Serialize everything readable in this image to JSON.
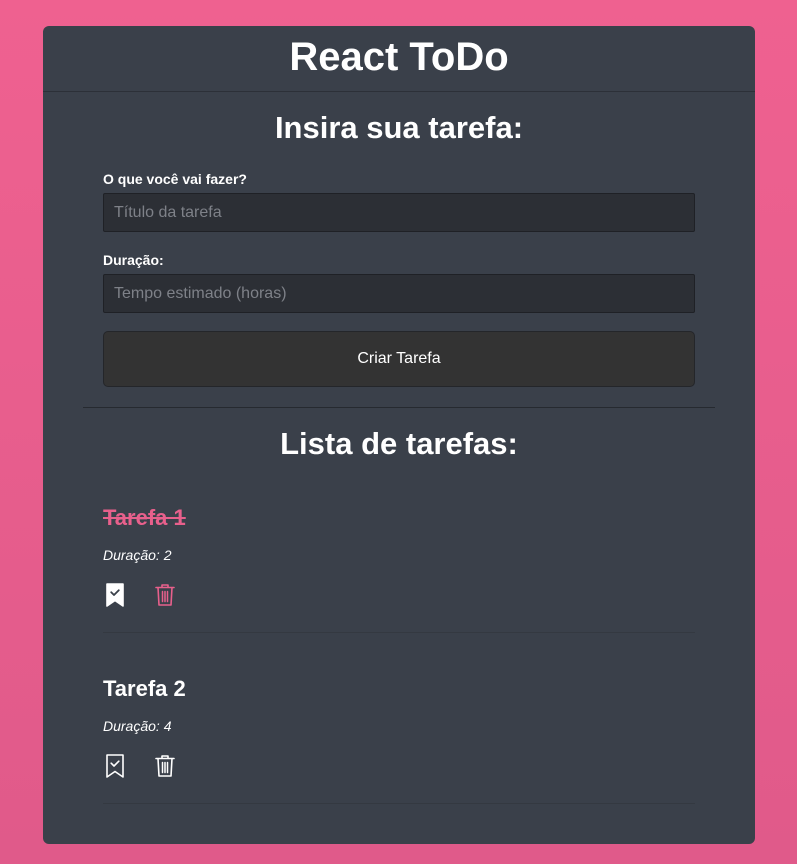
{
  "header": {
    "title": "React ToDo"
  },
  "form": {
    "heading": "Insira sua tarefa:",
    "title_label": "O que você vai fazer?",
    "title_placeholder": "Título da tarefa",
    "duration_label": "Duração:",
    "duration_placeholder": "Tempo estimado (horas)",
    "submit_label": "Criar Tarefa"
  },
  "list": {
    "heading": "Lista de tarefas:",
    "tasks": [
      {
        "title": "Tarefa 1",
        "duration_text": "Duração: 2",
        "done": true,
        "complete_icon": "bookmark-check-filled-icon",
        "delete_icon": "trash-icon"
      },
      {
        "title": "Tarefa 2",
        "duration_text": "Duração: 4",
        "done": false,
        "complete_icon": "bookmark-check-icon",
        "delete_icon": "trash-icon"
      }
    ]
  },
  "colors": {
    "background_pink": "#ef6190",
    "panel": "#3a404a",
    "accent": "#e8608c",
    "input_bg": "#2c2f35",
    "button_bg": "#333333"
  }
}
